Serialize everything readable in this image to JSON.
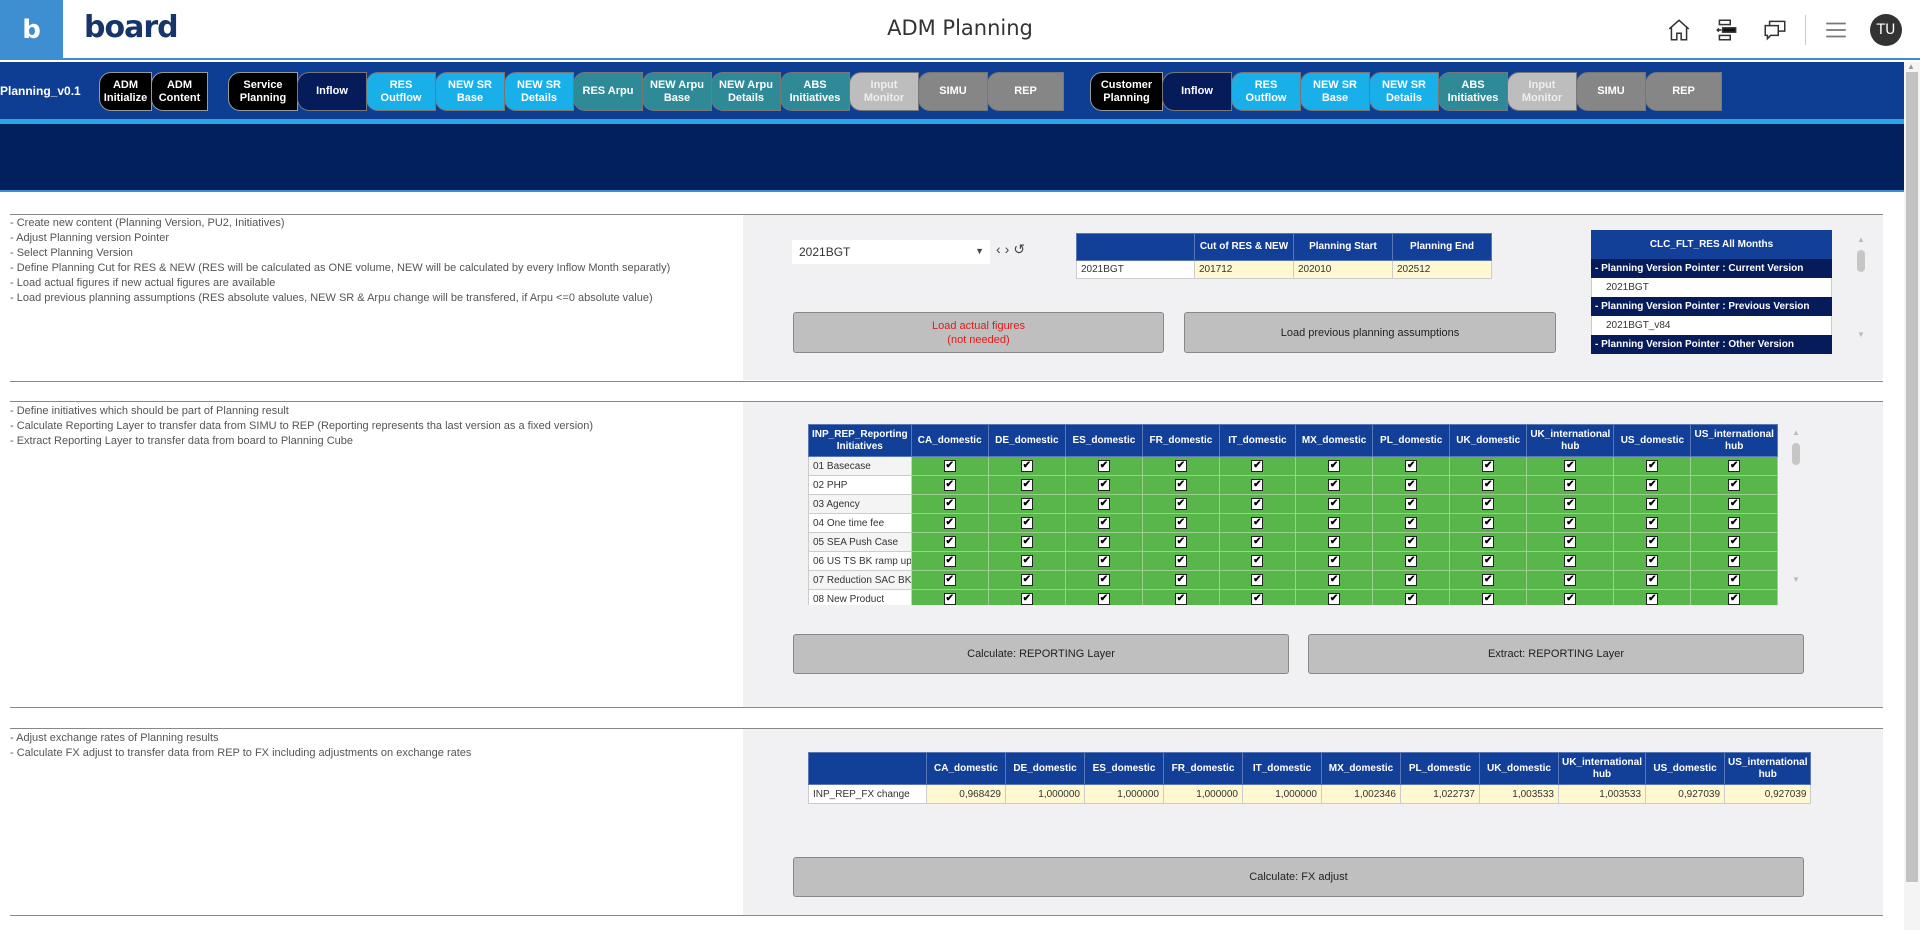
{
  "header": {
    "logo_letter": "b",
    "brand": "board",
    "title": "ADM Planning",
    "icons": [
      "home-icon",
      "layout-icon",
      "chat-icon",
      "menu-icon"
    ],
    "avatar_initials": "TU"
  },
  "nav": {
    "title": "Planning_v0.1",
    "groups": [
      {
        "tabs": [
          {
            "label": "ADM\nInitialize",
            "color": "black"
          },
          {
            "label": "ADM\nContent",
            "color": "black"
          }
        ]
      },
      {
        "tabs": [
          {
            "label": "Service\nPlanning",
            "color": "black"
          },
          {
            "label": "Inflow",
            "color": "navy"
          },
          {
            "label": "RES Outflow",
            "color": "cyan"
          },
          {
            "label": "NEW SR\nBase",
            "color": "cyan"
          },
          {
            "label": "NEW SR\nDetails",
            "color": "cyan"
          },
          {
            "label": "RES Arpu",
            "color": "teal"
          },
          {
            "label": "NEW Arpu\nBase",
            "color": "teal"
          },
          {
            "label": "NEW Arpu\nDetails",
            "color": "teal"
          },
          {
            "label": "ABS\nInitiatives",
            "color": "teal"
          },
          {
            "label": "Input\nMonitor",
            "color": "lightgray"
          },
          {
            "label": "SIMU",
            "color": "gray"
          },
          {
            "label": "REP",
            "color": "gray"
          }
        ]
      },
      {
        "tabs": [
          {
            "label": "Customer\nPlanning",
            "color": "black"
          },
          {
            "label": "Inflow",
            "color": "navy"
          },
          {
            "label": "RES Outflow",
            "color": "cyan"
          },
          {
            "label": "NEW SR\nBase",
            "color": "cyan"
          },
          {
            "label": "NEW SR\nDetails",
            "color": "cyan"
          },
          {
            "label": "ABS\nInitiatives",
            "color": "teal"
          },
          {
            "label": "Input\nMonitor",
            "color": "lightgray"
          },
          {
            "label": "SIMU",
            "color": "gray"
          },
          {
            "label": "REP",
            "color": "gray"
          }
        ]
      }
    ]
  },
  "section1": {
    "description": [
      "- Create new content (Planning Version, PU2, Initiatives)",
      "- Adjust Planning version Pointer",
      "- Select Planning Version",
      "- Define Planning Cut for RES & NEW (RES will be calculated as ONE volume, NEW will be calculated by every Inflow Month separatly)",
      "- Load actual figures if new actual figures are available",
      "- Load previous planning assumptions (RES absolute values, NEW SR & Arpu change will be transfered, if Arpu <=0 absolute value)"
    ],
    "version_select": {
      "value": "2021BGT"
    },
    "cut_table": {
      "headers": [
        "",
        "Cut of RES & NEW",
        "Planning Start",
        "Planning End"
      ],
      "row": [
        "2021BGT",
        "201712",
        "202010",
        "202512"
      ]
    },
    "load_actual_button": "Load actual figures\n(not needed)",
    "load_previous_button": "Load previous planning assumptions",
    "clc_box": {
      "title": "CLC_FLT_RES All Months",
      "rows": [
        {
          "type": "header",
          "label": "-  Planning Version Pointer : Current Version"
        },
        {
          "type": "value",
          "label": "2021BGT"
        },
        {
          "type": "header",
          "label": "-  Planning Version Pointer : Previous Version"
        },
        {
          "type": "value",
          "label": "2021BGT_v84"
        },
        {
          "type": "header",
          "label": "-  Planning Version Pointer : Other Version"
        }
      ]
    }
  },
  "section2": {
    "description": [
      "- Define initiatives which should be part of Planning result",
      "- Calculate Reporting Layer to transfer data from SIMU to REP (Reporting represents tha last version as a fixed version)",
      "- Extract Reporting Layer to transfer data from board to Planning Cube"
    ],
    "initiatives_table": {
      "corner": "INP_REP_Reporting Initiatives",
      "columns": [
        "CA_domestic",
        "DE_domestic",
        "ES_domestic",
        "FR_domestic",
        "IT_domestic",
        "MX_domestic",
        "PL_domestic",
        "UK_domestic",
        "UK_international hub",
        "US_domestic",
        "US_international hub"
      ],
      "rows": [
        "01 Basecase",
        "02 PHP",
        "03 Agency",
        "04 One time fee",
        "05 SEA Push Case",
        "06 US TS BK ramp up",
        "07 Reduction SAC BK",
        "08 New Product"
      ],
      "all_checked": true
    },
    "calculate_button": "Calculate: REPORTING Layer",
    "extract_button": "Extract: REPORTING Layer"
  },
  "section3": {
    "description": [
      "- Adjust exchange rates of Planning results",
      "- Calculate FX adjust to transfer data from REP to FX including adjustments on exchange rates"
    ],
    "fx_table": {
      "columns": [
        "CA_domestic",
        "DE_domestic",
        "ES_domestic",
        "FR_domestic",
        "IT_domestic",
        "MX_domestic",
        "PL_domestic",
        "UK_domestic",
        "UK_international hub",
        "US_domestic",
        "US_international hub"
      ],
      "row_label": "INP_REP_FX change",
      "values": [
        "0,968429",
        "1,000000",
        "1,000000",
        "1,000000",
        "1,000000",
        "1,002346",
        "1,022737",
        "1,003533",
        "1,003533",
        "0,927039",
        "0,927039"
      ]
    },
    "fx_button": "Calculate: FX adjust"
  },
  "colors": {
    "brand_blue": "#3d8fd1",
    "nav_blue": "#0e3e94",
    "dark_band": "#02205e",
    "table_header": "#123f98",
    "check_green": "#58b64a",
    "input_yellow": "#fff8d0",
    "warning_red": "#e41b1b"
  }
}
